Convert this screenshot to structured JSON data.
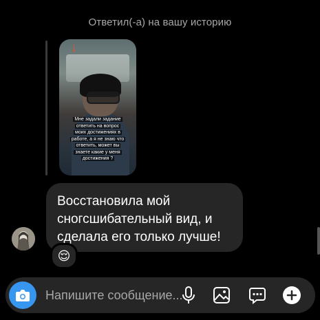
{
  "reply": {
    "header": "Ответил(-а) на вашу историю",
    "story_caption_lines": [
      "Мне задали задание",
      "ответить на вопрос",
      "моих достижениях в",
      "работе, а я не знаю что",
      "ответить, может вы",
      "знаете какие у меня",
      "достижения ?"
    ]
  },
  "message": {
    "text": "Восстановила мой сногсшибательный вид, и сделала его только лучше!",
    "reaction": "😌"
  },
  "composer": {
    "placeholder": "Напишите сообщение...",
    "icons": [
      "camera-icon",
      "microphone-icon",
      "gallery-icon",
      "sticker-icon",
      "plus-icon"
    ]
  },
  "colors": {
    "background": "#000000",
    "bubble": "#262626",
    "accent": "#3797f0",
    "muted_text": "#a8a8a8"
  }
}
